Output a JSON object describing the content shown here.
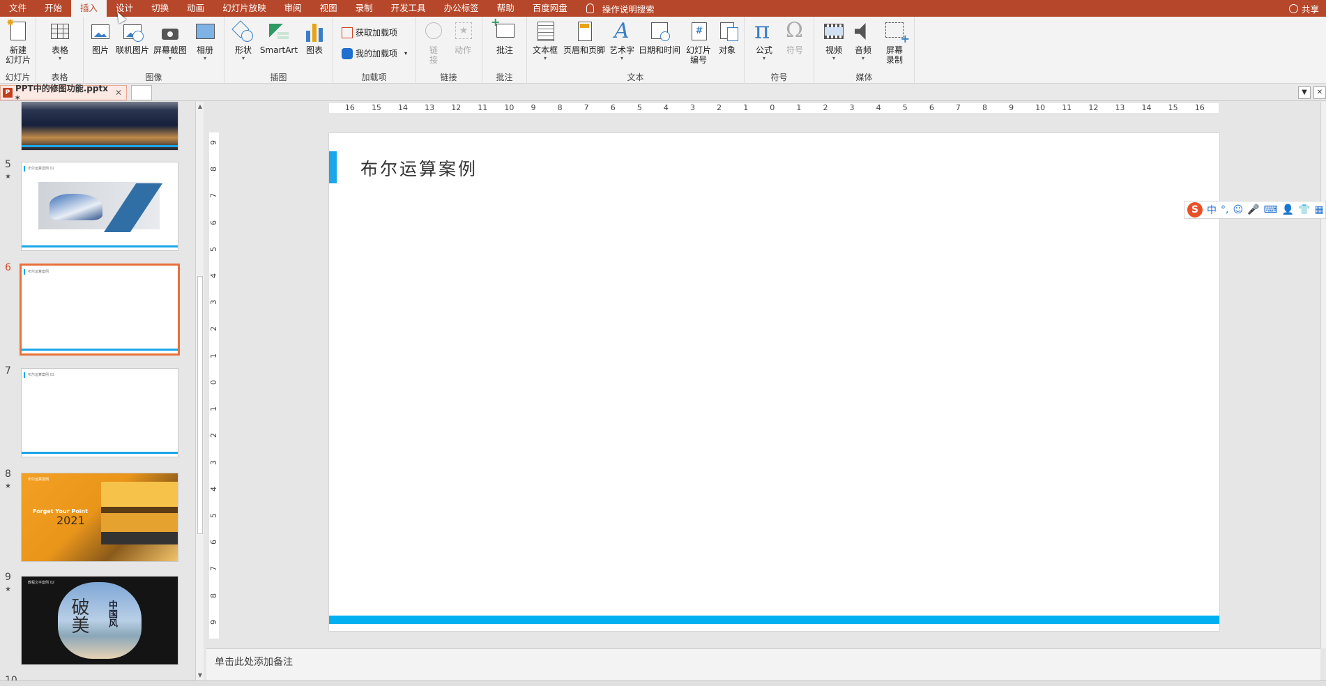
{
  "menu": {
    "tabs": [
      "文件",
      "开始",
      "插入",
      "设计",
      "切换",
      "动画",
      "幻灯片放映",
      "审阅",
      "视图",
      "录制",
      "开发工具",
      "办公标签",
      "帮助",
      "百度网盘"
    ],
    "active_index": 2,
    "search_label": "操作说明搜索",
    "share_label": "共享"
  },
  "ribbon": {
    "groups": {
      "slides": "幻灯片",
      "tables": "表格",
      "images": "图像",
      "illustrations": "插图",
      "addins": "加载项",
      "links": "链接",
      "comments": "批注",
      "text": "文本",
      "symbols": "符号",
      "media": "媒体"
    },
    "buttons": {
      "new_slide_1": "新建",
      "new_slide_2": "幻灯片",
      "table": "表格",
      "picture": "图片",
      "online_picture": "联机图片",
      "screenshot": "屏幕截图",
      "album": "相册",
      "shapes": "形状",
      "smartart": "SmartArt",
      "chart": "图表",
      "get_addins": "获取加载项",
      "my_addins": "我的加载项",
      "link_1": "链",
      "link_2": "接",
      "action": "动作",
      "comment": "批注",
      "textbox": "文本框",
      "header_footer": "页眉和页脚",
      "wordart": "艺术字",
      "datetime": "日期和时间",
      "slide_number_1": "幻灯片",
      "slide_number_2": "编号",
      "object": "对象",
      "equation": "公式",
      "symbol": "符号",
      "video": "视频",
      "audio": "音频",
      "screen_rec_1": "屏幕",
      "screen_rec_2": "录制"
    }
  },
  "document_tab": {
    "filename": "PPT中的修图功能.pptx *",
    "icon_text": "P"
  },
  "thumbnails": [
    {
      "number": "5",
      "title": "布尔运算案例 02"
    },
    {
      "number": "6",
      "title": "布尔运算案例"
    },
    {
      "number": "7",
      "title": "布尔运算案例 03"
    },
    {
      "number": "8",
      "title": "布尔运算案例"
    },
    {
      "number": "9",
      "title": "教程文字案例 02"
    },
    {
      "number": "10",
      "title": ""
    }
  ],
  "thumb_texts": {
    "orange_line1": "Forget Your Point",
    "orange_year": "2021",
    "dark_big": "中国风",
    "dark_script": "破美"
  },
  "ruler": {
    "h_ticks": [
      "16",
      "15",
      "14",
      "13",
      "12",
      "11",
      "10",
      "9",
      "8",
      "7",
      "6",
      "5",
      "4",
      "3",
      "2",
      "1",
      "0",
      "1",
      "2",
      "3",
      "4",
      "5",
      "6",
      "7",
      "8",
      "9",
      "10",
      "11",
      "12",
      "13",
      "14",
      "15",
      "16"
    ],
    "v_ticks": [
      "9",
      "8",
      "7",
      "6",
      "5",
      "4",
      "3",
      "2",
      "1",
      "0",
      "1",
      "2",
      "3",
      "4",
      "5",
      "6",
      "7",
      "8",
      "9"
    ]
  },
  "slide": {
    "title": "布尔运算案例"
  },
  "ime": {
    "logo": "S",
    "items": [
      "中",
      "°,",
      "☺",
      "🎤",
      "⌨",
      "👤",
      "👕",
      "▦"
    ]
  },
  "notes": {
    "placeholder": "单击此处添加备注"
  },
  "colors": {
    "ribbon_accent": "#b7472a",
    "slide_accent": "#1aa6e8",
    "slide_bottom_bar": "#00b0f0",
    "selected_thumb_border": "#e8703a"
  }
}
